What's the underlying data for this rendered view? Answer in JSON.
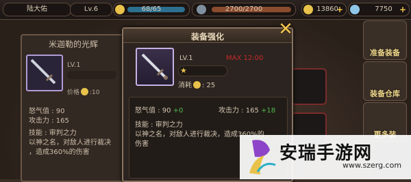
{
  "topbar": {
    "player_name": "陆大佑",
    "level": "Lv.6",
    "energy": "68/65",
    "hp": "2700/2700",
    "gold": "13860",
    "gems": "7750"
  },
  "left_panel": {
    "title": "米迦勒的光辉",
    "level": "LV.1",
    "price_label": "价格",
    "price_value": ":10",
    "rage": "怒气值 : 90",
    "attack": "攻击力 : 165",
    "skill_name": "技能 : 审判之力",
    "skill_line1": "以神之名，对敌人进行裁决",
    "skill_line2": "，造成360%的伤害"
  },
  "dialog": {
    "title": "装备强化",
    "level": "LV.1",
    "red_text": "MAX 12:00",
    "cost_label": "消耗",
    "cost_value": ": 25",
    "rage_label": "怒气值 : 90",
    "rage_bonus": "+0",
    "attack_label": "攻击力 : 165",
    "attack_bonus": "+18",
    "skill_name": "技能 : 审判之力",
    "skill_line1": "以神之名，对敌人进行裁决，造成360%的",
    "skill_line2": "伤害"
  },
  "side_buttons": {
    "equip_label": "准备装备",
    "warehouse_label": "装备仓库",
    "third_label": "更多装"
  },
  "watermark": {
    "title": "安瑞手游网",
    "url": "www.szerg.com"
  },
  "colors": {
    "accent_gold": "#f3c64b",
    "bonus_green": "#4fb84f",
    "warning_red": "#c62a2a"
  }
}
